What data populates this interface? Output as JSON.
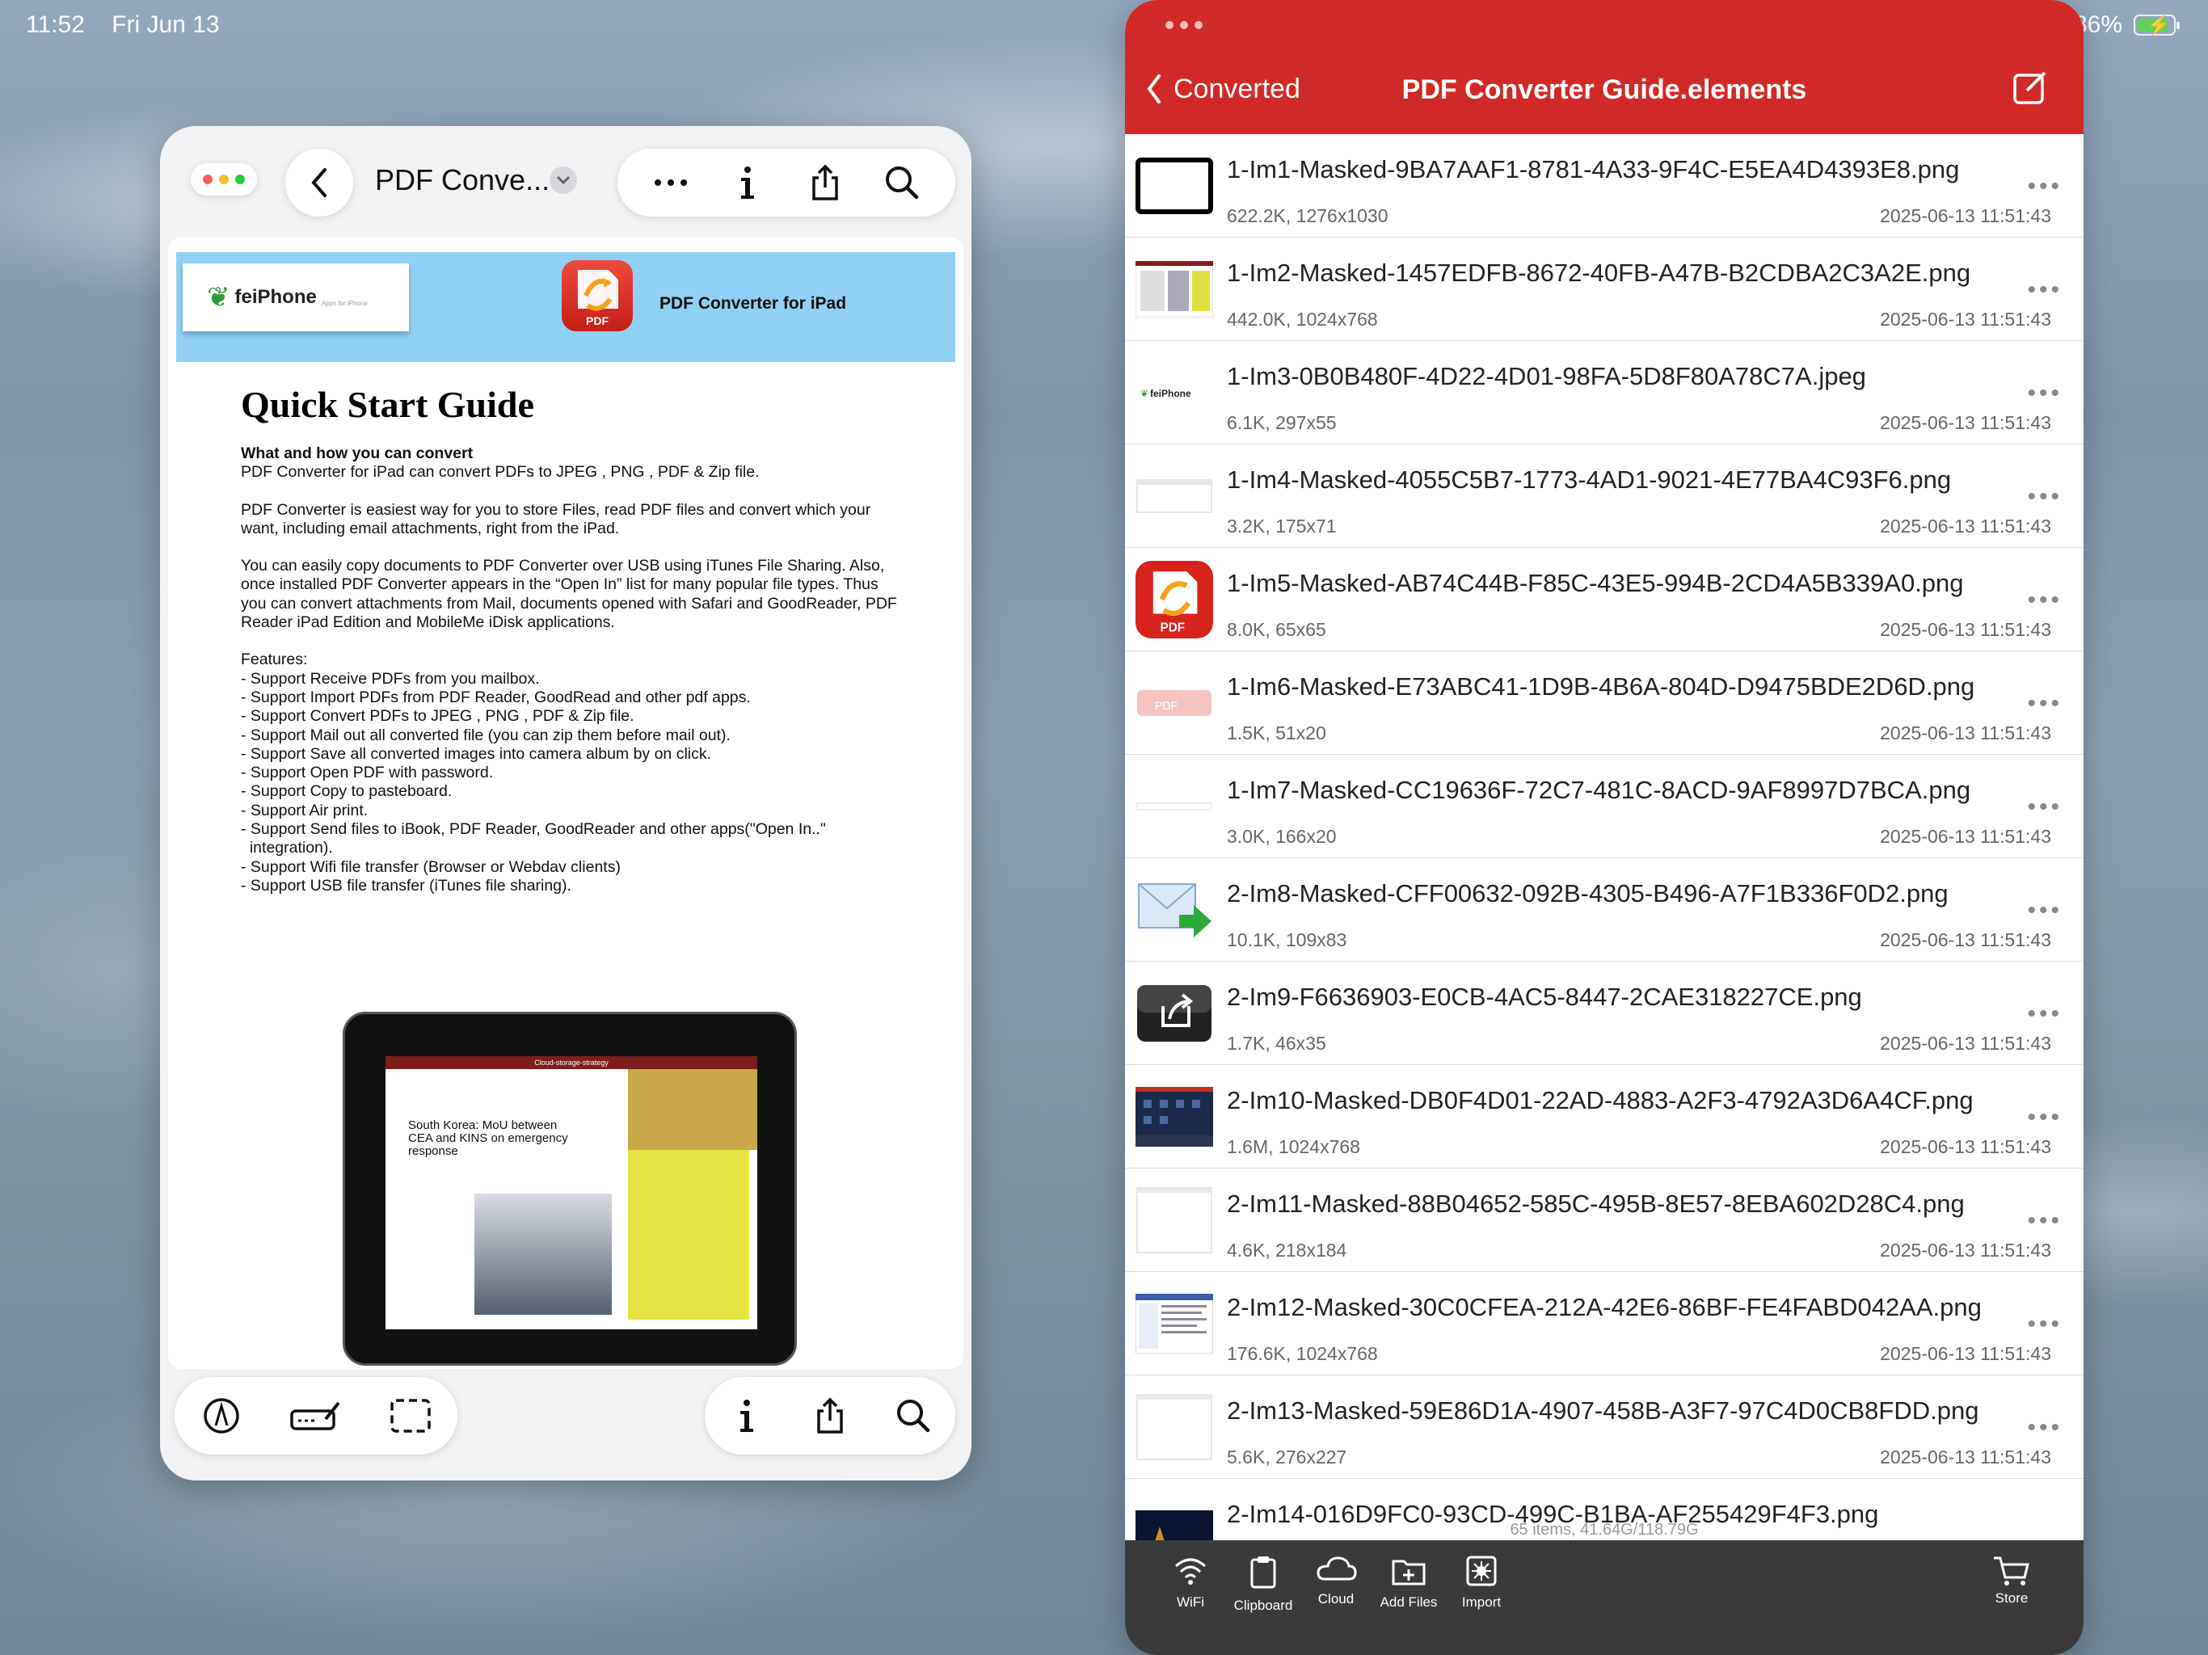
{
  "status_bar": {
    "time": "11:52",
    "date": "Fri Jun 13",
    "battery_percent": "86%",
    "battery_level": 0.86
  },
  "left_app": {
    "document_title": "PDF Conve...",
    "pdf": {
      "brand": "feiPhone",
      "brand_tagline": "Apps for iPhone",
      "header_title": "PDF Converter for iPad",
      "app_icon_label": "PDF",
      "heading": "Quick Start Guide",
      "subheading": "What and how you can convert",
      "p1": "PDF Converter for iPad can convert PDFs to JPEG , PNG , PDF & Zip file.",
      "p2": "PDF Converter is easiest way for you to store Files, read PDF files and convert which your want, including email attachments, right from the iPad.",
      "p3": "You can easily copy documents to PDF Converter over USB using iTunes File Sharing. Also, once installed PDF Converter appears in the “Open In” list for many popular file types. Thus you can convert attachments from Mail, documents opened with Safari and GoodReader, PDF Reader iPad Edition and MobileMe iDisk applications.",
      "features_title": "Features:",
      "features": [
        "- Support Receive PDFs from you mailbox.",
        "- Support Import PDFs from PDF Reader, GoodRead and other pdf apps.",
        "- Support Convert PDFs to JPEG , PNG , PDF & Zip file.",
        "- Support Mail out all converted file (you can zip them before mail out).",
        "- Support Save all converted images into camera album by on click.",
        "- Support Open PDF with password.",
        "- Support Copy to pasteboard.",
        "- Support Air print.",
        "- Support Send files to iBook, PDF Reader, GoodReader and other apps(\"Open In..\"\n  integration).",
        "- Support Wifi file transfer (Browser or Webdav clients)",
        "- Support USB file transfer (iTunes file sharing)."
      ],
      "ipad_screen_title": "Cloud-storage-strategy",
      "ipad_headline": "South Korea: MoU between CEA and KINS on emergency response"
    }
  },
  "right_app": {
    "back_label": "Converted",
    "title": "PDF Converter Guide.elements",
    "files": [
      {
        "name": "1-Im1-Masked-9BA7AAF1-8781-4A33-9F4C-E5EA4D4393E8.png",
        "size": "622.2K, 1276x1030",
        "date": "2025-06-13 11:51:43",
        "thumb": "black-frame"
      },
      {
        "name": "1-Im2-Masked-1457EDFB-8672-40FB-A47B-B2CDBA2C3A2E.png",
        "size": "442.0K, 1024x768",
        "date": "2025-06-13 11:51:43",
        "thumb": "magazine"
      },
      {
        "name": "1-Im3-0B0B480F-4D22-4D01-98FA-5D8F80A78C7A.jpeg",
        "size": "6.1K, 297x55",
        "date": "2025-06-13 11:51:43",
        "thumb": "feiphone-logo"
      },
      {
        "name": "1-Im4-Masked-4055C5B7-1773-4AD1-9021-4E77BA4C93F6.png",
        "size": "3.2K, 175x71",
        "date": "2025-06-13 11:51:43",
        "thumb": "blank-shadow"
      },
      {
        "name": "1-Im5-Masked-AB74C44B-F85C-43E5-994B-2CD4A5B339A0.png",
        "size": "8.0K, 65x65",
        "date": "2025-06-13 11:51:43",
        "thumb": "pdf-app-icon"
      },
      {
        "name": "1-Im6-Masked-E73ABC41-1D9B-4B6A-804D-D9475BDE2D6D.png",
        "size": "1.5K, 51x20",
        "date": "2025-06-13 11:51:43",
        "thumb": "pdf-reflection"
      },
      {
        "name": "1-Im7-Masked-CC19636F-72C7-481C-8ACD-9AF8997D7BCA.png",
        "size": "3.0K, 166x20",
        "date": "2025-06-13 11:51:43",
        "thumb": "thin-line"
      },
      {
        "name": "2-Im8-Masked-CFF00632-092B-4305-B496-A7F1B336F0D2.png",
        "size": "10.1K, 109x83",
        "date": "2025-06-13 11:51:43",
        "thumb": "mail-arrow"
      },
      {
        "name": "2-Im9-F6636903-E0CB-4AC5-8447-2CAE318227CE.png",
        "size": "1.7K, 46x35",
        "date": "2025-06-13 11:51:43",
        "thumb": "share-button"
      },
      {
        "name": "2-Im10-Masked-DB0F4D01-22AD-4883-A2F3-4792A3D6A4CF.png",
        "size": "1.6M, 1024x768",
        "date": "2025-06-13 11:51:43",
        "thumb": "ipad-home"
      },
      {
        "name": "2-Im11-Masked-88B04652-585C-495B-8E57-8EBA602D28C4.png",
        "size": "4.6K, 218x184",
        "date": "2025-06-13 11:51:43",
        "thumb": "blank-card"
      },
      {
        "name": "2-Im12-Masked-30C0CFEA-212A-42E6-86BF-FE4FABD042AA.png",
        "size": "176.6K, 1024x768",
        "date": "2025-06-13 11:51:43",
        "thumb": "screenshot"
      },
      {
        "name": "2-Im13-Masked-59E86D1A-4907-458B-A3F7-97C4D0CB8FDD.png",
        "size": "5.6K, 276x227",
        "date": "2025-06-13 11:51:43",
        "thumb": "blank-card"
      },
      {
        "name": "2-Im14-016D9FC0-93CD-499C-B1BA-AF255429F4F3.png",
        "size": "",
        "date": "",
        "thumb": "dark-wallpaper"
      }
    ],
    "more_glyph": "•••",
    "item_count": "65 items, 41.64G/118.79G",
    "toolbar": [
      {
        "label": "WiFi",
        "icon": "wifi-icon"
      },
      {
        "label": "Clipboard",
        "icon": "clipboard-icon"
      },
      {
        "label": "Cloud",
        "icon": "cloud-icon"
      },
      {
        "label": "Add Files",
        "icon": "add-files-icon"
      },
      {
        "label": "Import",
        "icon": "import-icon"
      }
    ],
    "store_label": "Store",
    "accent_color": "#d12a26"
  }
}
